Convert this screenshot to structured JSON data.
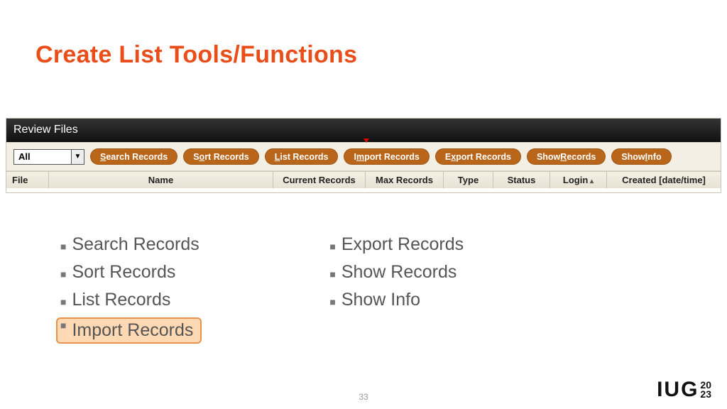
{
  "title": "Create List Tools/Functions",
  "app": {
    "titlebar": "Review Files",
    "dropdown": {
      "selected": "All"
    },
    "buttons": [
      {
        "pre": "",
        "ul": "S",
        "post": "earch Records"
      },
      {
        "pre": "S",
        "ul": "o",
        "post": "rt Records"
      },
      {
        "pre": "",
        "ul": "L",
        "post": "ist Records"
      },
      {
        "pre": "I",
        "ul": "m",
        "post": "port Records"
      },
      {
        "pre": "E",
        "ul": "x",
        "post": "port Records"
      },
      {
        "pre": "Show ",
        "ul": "R",
        "post": "ecords"
      },
      {
        "pre": "Show ",
        "ul": "I",
        "post": "nfo"
      }
    ],
    "columns": {
      "file": "File",
      "name": "Name",
      "cur": "Current Records",
      "max": "Max Records",
      "type": "Type",
      "stat": "Status",
      "login": "Login",
      "created": "Created [date/time]"
    }
  },
  "bullets_left": [
    {
      "label": "Search Records",
      "highlight": false
    },
    {
      "label": "Sort Records",
      "highlight": false
    },
    {
      "label": "List Records",
      "highlight": false
    },
    {
      "label": "Import Records",
      "highlight": true
    }
  ],
  "bullets_right": [
    {
      "label": "Export Records",
      "highlight": false
    },
    {
      "label": "Show Records",
      "highlight": false
    },
    {
      "label": "Show Info",
      "highlight": false
    }
  ],
  "page_number": "33",
  "logo": {
    "text": "IUG",
    "year_top": "20",
    "year_bottom": "23"
  }
}
